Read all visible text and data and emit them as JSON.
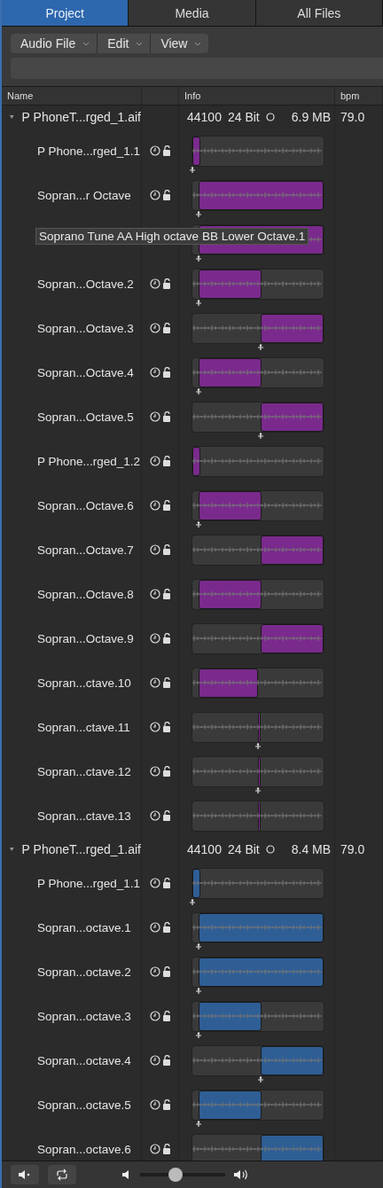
{
  "tabs": [
    {
      "label": "Project",
      "selected": true
    },
    {
      "label": "Media",
      "selected": false
    },
    {
      "label": "All Files",
      "selected": false
    }
  ],
  "menus": [
    "Audio File",
    "Edit",
    "View"
  ],
  "columns": [
    "Name",
    "Info",
    "bpm"
  ],
  "groups": [
    {
      "name": "P PhoneT...rged_1.aif",
      "rate": "44100",
      "depth": "24 Bit",
      "size": "6.9 MB",
      "bpm": "79.0",
      "expanded": true,
      "color": "#7a2a8c",
      "regions": [
        {
          "name": "P Phone...rged_1.1",
          "kind": "sliver",
          "anchor": true
        },
        {
          "name": "Sopran...r Octave",
          "kind": "full",
          "anchor": true
        },
        {
          "tooltip": "Soprano Tune AA High octave BB Lower Octave.1",
          "kind": "full",
          "anchor": true
        },
        {
          "name": "Sopran...Octave.2",
          "kind": "left",
          "anchor": true
        },
        {
          "name": "Sopran...Octave.3",
          "kind": "right",
          "anchor": true
        },
        {
          "name": "Sopran...Octave.4",
          "kind": "left",
          "anchor": true
        },
        {
          "name": "Sopran...Octave.5",
          "kind": "right",
          "anchor": true
        },
        {
          "name": "P Phone...rged_1.2",
          "kind": "sliver",
          "anchor": false
        },
        {
          "name": "Sopran...Octave.6",
          "kind": "left",
          "anchor": true
        },
        {
          "name": "Sopran...Octave.7",
          "kind": "right",
          "anchor": false
        },
        {
          "name": "Sopran...Octave.8",
          "kind": "left",
          "anchor": false
        },
        {
          "name": "Sopran...Octave.9",
          "kind": "right",
          "anchor": false
        },
        {
          "name": "Sopran...ctave.10",
          "kind": "short",
          "anchor": false
        },
        {
          "name": "Sopran...ctave.11",
          "kind": "line",
          "anchor": true
        },
        {
          "name": "Sopran...ctave.12",
          "kind": "line",
          "anchor": true
        },
        {
          "name": "Sopran...ctave.13",
          "kind": "line",
          "anchor": false
        }
      ]
    },
    {
      "name": "P PhoneT...rged_1.aif",
      "rate": "44100",
      "depth": "24 Bit",
      "size": "8.4 MB",
      "bpm": "79.0",
      "expanded": true,
      "color": "#2f5e95",
      "regions": [
        {
          "name": "P Phone...rged_1.1",
          "kind": "sliver",
          "anchor": true
        },
        {
          "name": "Sopran...octave.1",
          "kind": "full",
          "anchor": true
        },
        {
          "name": "Sopran...octave.2",
          "kind": "full",
          "anchor": true
        },
        {
          "name": "Sopran...octave.3",
          "kind": "left",
          "anchor": true
        },
        {
          "name": "Sopran...octave.4",
          "kind": "right",
          "anchor": true
        },
        {
          "name": "Sopran...octave.5",
          "kind": "left",
          "anchor": true
        },
        {
          "name": "Sopran...octave.6",
          "kind": "right",
          "anchor": false
        }
      ]
    }
  ],
  "footer": {
    "volume": {
      "level": 0.4
    }
  }
}
